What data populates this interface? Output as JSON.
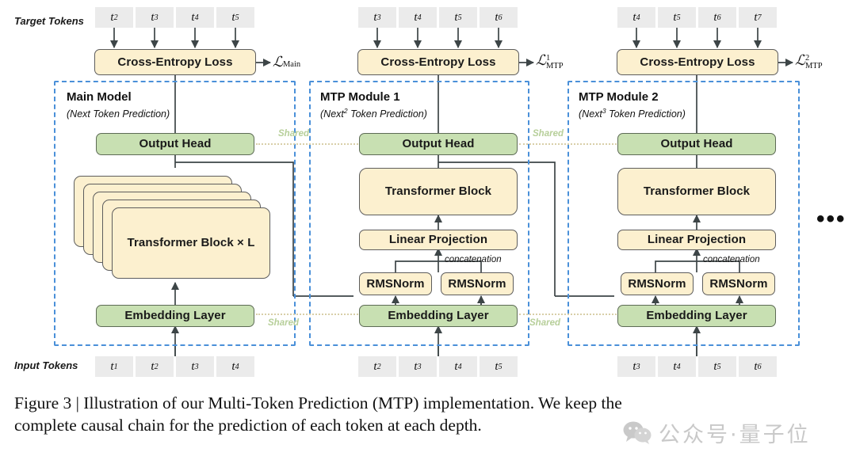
{
  "figure": {
    "row_labels": {
      "target": "Target Tokens",
      "input": "Input Tokens"
    },
    "caption_line1": "Figure 3 | Illustration of our Multi-Token Prediction (MTP) implementation.  We keep the",
    "caption_line2": "complete causal chain for the prediction of each token at each depth.",
    "ellipsis": "•••",
    "shared_label": "Shared",
    "concat_label": "concatenation",
    "watermark_text": "公众号·量子位",
    "colors": {
      "yellow_fill": "#fcf0cf",
      "green_fill": "#c8e0b2",
      "box_border": "#5d5d5d",
      "dashed_frame": "#4a90d9",
      "token_chip": "#ebebeb",
      "shared_text": "#b7cf9a",
      "wire": "#3d4547"
    }
  },
  "columns": [
    {
      "id": "main",
      "title": "Main Model",
      "subtitle_pre": "(Next",
      "subtitle_sup": "",
      "subtitle_post": " Token Prediction)",
      "loss_name": "Cross-Entropy Loss",
      "loss_symbol": {
        "base": "ℒ",
        "sub": "Main",
        "sup": ""
      },
      "target_tokens": [
        {
          "base": "t",
          "sub": "2"
        },
        {
          "base": "t",
          "sub": "3"
        },
        {
          "base": "t",
          "sub": "4"
        },
        {
          "base": "t",
          "sub": "5"
        }
      ],
      "input_tokens": [
        {
          "base": "t",
          "sub": "1"
        },
        {
          "base": "t",
          "sub": "2"
        },
        {
          "base": "t",
          "sub": "3"
        },
        {
          "base": "t",
          "sub": "4"
        }
      ],
      "blocks": {
        "output_head": "Output Head",
        "transformer": "Transformer Block × L",
        "embedding": "Embedding Layer"
      }
    },
    {
      "id": "mtp1",
      "title": "MTP Module 1",
      "subtitle_pre": "(Next",
      "subtitle_sup": "2",
      "subtitle_post": " Token Prediction)",
      "loss_name": "Cross-Entropy Loss",
      "loss_symbol": {
        "base": "ℒ",
        "sub": "MTP",
        "sup": "1"
      },
      "target_tokens": [
        {
          "base": "t",
          "sub": "3"
        },
        {
          "base": "t",
          "sub": "4"
        },
        {
          "base": "t",
          "sub": "5"
        },
        {
          "base": "t",
          "sub": "6"
        }
      ],
      "input_tokens": [
        {
          "base": "t",
          "sub": "2"
        },
        {
          "base": "t",
          "sub": "3"
        },
        {
          "base": "t",
          "sub": "4"
        },
        {
          "base": "t",
          "sub": "5"
        }
      ],
      "blocks": {
        "output_head": "Output Head",
        "transformer": "Transformer Block",
        "linear": "Linear Projection",
        "rmsnorm_left": "RMSNorm",
        "rmsnorm_right": "RMSNorm",
        "embedding": "Embedding Layer"
      }
    },
    {
      "id": "mtp2",
      "title": "MTP Module 2",
      "subtitle_pre": "(Next",
      "subtitle_sup": "3",
      "subtitle_post": " Token Prediction)",
      "loss_name": "Cross-Entropy Loss",
      "loss_symbol": {
        "base": "ℒ",
        "sub": "MTP",
        "sup": "2"
      },
      "target_tokens": [
        {
          "base": "t",
          "sub": "4"
        },
        {
          "base": "t",
          "sub": "5"
        },
        {
          "base": "t",
          "sub": "6"
        },
        {
          "base": "t",
          "sub": "7"
        }
      ],
      "input_tokens": [
        {
          "base": "t",
          "sub": "3"
        },
        {
          "base": "t",
          "sub": "4"
        },
        {
          "base": "t",
          "sub": "5"
        },
        {
          "base": "t",
          "sub": "6"
        }
      ],
      "blocks": {
        "output_head": "Output Head",
        "transformer": "Transformer Block",
        "linear": "Linear Projection",
        "rmsnorm_left": "RMSNorm",
        "rmsnorm_right": "RMSNorm",
        "embedding": "Embedding Layer"
      }
    }
  ]
}
